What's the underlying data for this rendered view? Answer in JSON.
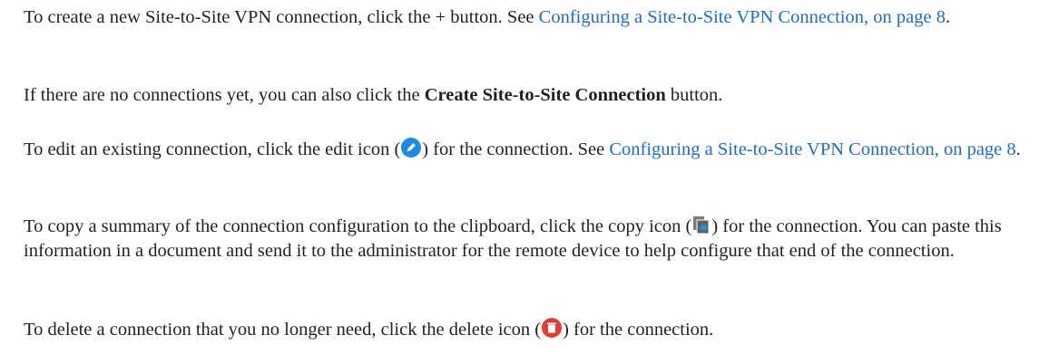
{
  "bullets": [
    {
      "text_before": "To create a new Site-to-Site VPN connection, click the + button. See ",
      "link": "Configuring a Site-to-Site VPN Connection, on page 8",
      "text_after": "."
    },
    {
      "text_before": "To edit an existing connection, click the edit icon (",
      "icon": "edit-icon",
      "text_mid": ") for the connection. See ",
      "link": "Configuring a Site-to-Site VPN Connection, on page 8",
      "text_after": "."
    },
    {
      "text_before": "To copy a summary of the connection configuration to the clipboard, click the copy icon (",
      "icon": "copy-icon",
      "text_after": ") for the connection. You can paste this information in a document and send it to the administrator for the remote device to help configure that end of the connection."
    },
    {
      "text_before": "To delete a connection that you no longer need, click the delete icon (",
      "icon": "delete-icon",
      "text_after": ") for the connection."
    }
  ],
  "note": {
    "text_before": "If there are no connections yet, you can also click the ",
    "bold": "Create Site-to-Site Connection",
    "text_after": " button."
  },
  "bullet_glyph": "•",
  "colors": {
    "text": "#231f20",
    "link": "#1a6ad8",
    "edit_icon": "#1e88e5",
    "delete_icon": "#e53935"
  }
}
